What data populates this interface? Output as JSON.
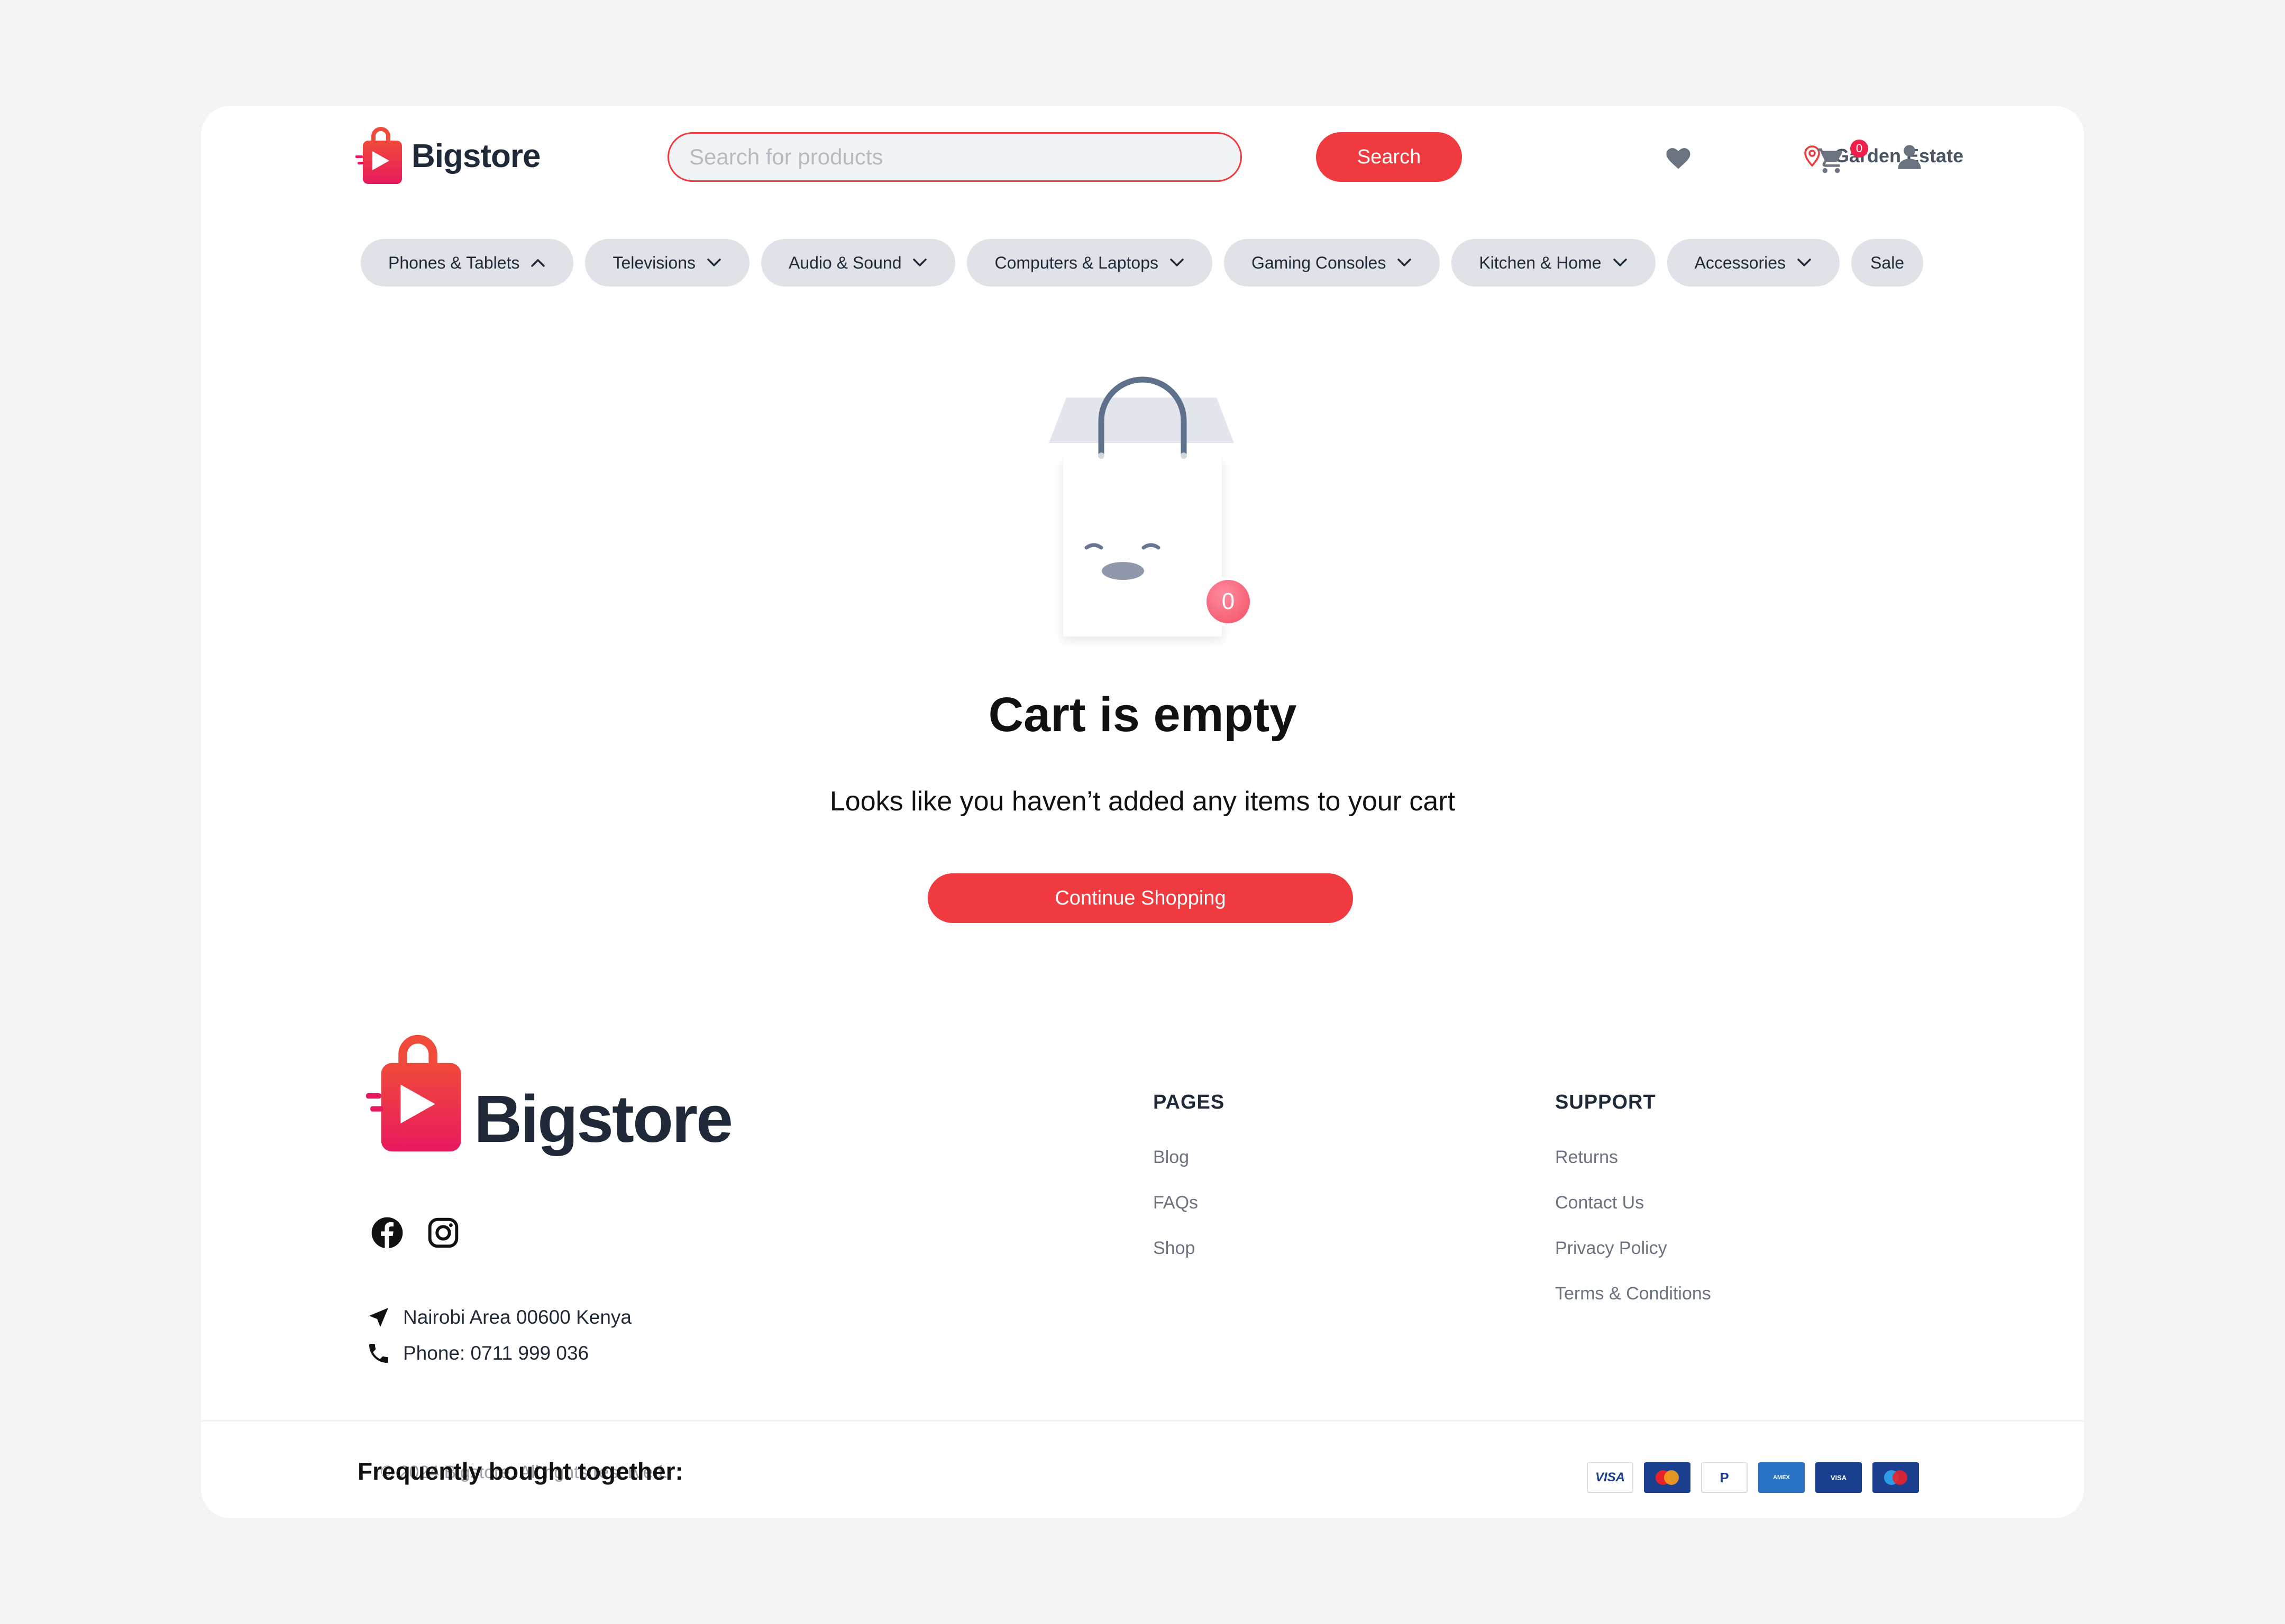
{
  "brand": {
    "name": "Bigstore"
  },
  "search": {
    "placeholder": "Search for products",
    "value": "",
    "button_label": "Search"
  },
  "header": {
    "location": "Garden Estate",
    "cart_count": "0"
  },
  "nav": {
    "items": [
      {
        "label": "Phones & Tablets",
        "chevron": "up"
      },
      {
        "label": "Televisions",
        "chevron": "down"
      },
      {
        "label": "Audio & Sound",
        "chevron": "down"
      },
      {
        "label": "Computers & Laptops",
        "chevron": "down"
      },
      {
        "label": "Gaming Consoles",
        "chevron": "down"
      },
      {
        "label": "Kitchen & Home",
        "chevron": "down"
      },
      {
        "label": "Accessories",
        "chevron": "down"
      },
      {
        "label": "Sale",
        "chevron": ""
      }
    ]
  },
  "empty": {
    "badge": "0",
    "title": "Cart is empty",
    "subtitle": "Looks like you haven’t added any items to your cart",
    "button_label": "Continue Shopping"
  },
  "footer": {
    "address": "Nairobi Area 00600 Kenya",
    "phone": "Phone: 0711 999 036",
    "pages_heading": "PAGES",
    "pages": [
      "Blog",
      "FAQs",
      "Shop"
    ],
    "support_heading": "SUPPORT",
    "support": [
      "Returns",
      "Contact Us",
      "Privacy Policy",
      "Terms & Conditions"
    ],
    "copyright": "© 2024 Bigstore. All rights reserved.",
    "frequently_bought": "Frequently bought together:",
    "payment_icons": [
      "visa-card-icon",
      "mastercard-icon",
      "paypal-icon",
      "american-express-icon",
      "visa-electron-icon",
      "maestro-icon"
    ]
  },
  "colors": {
    "accent": "#ef3a3f",
    "pill_bg": "#dfe3e8",
    "text_dark": "#1f2937",
    "muted": "#6b7280",
    "badge": "#ef1e4b"
  }
}
